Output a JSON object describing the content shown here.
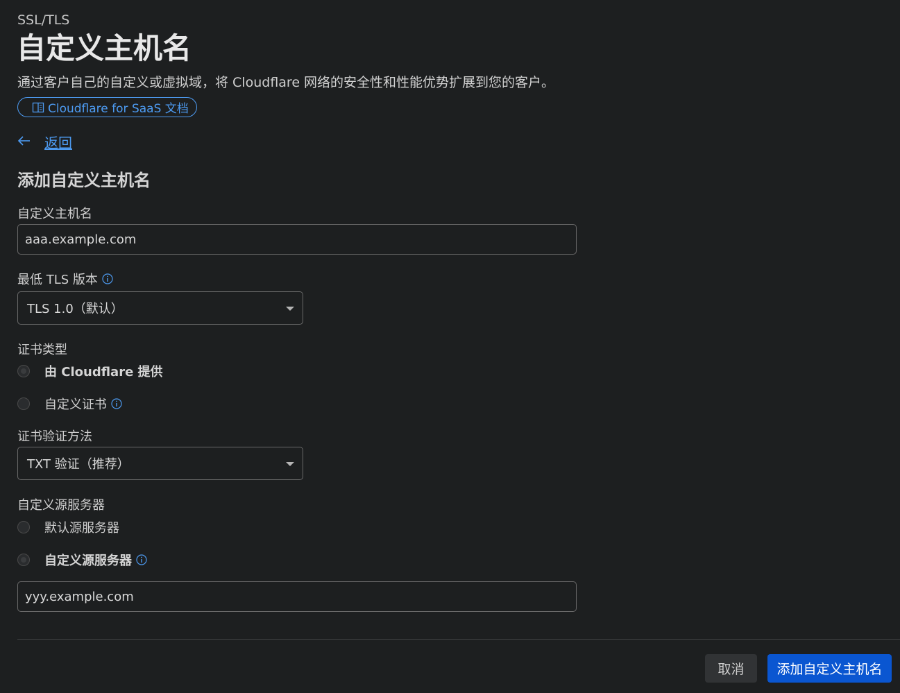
{
  "header": {
    "breadcrumb": "SSL/TLS",
    "title": "自定义主机名",
    "description": "通过客户自己的自定义或虚拟域，将 Cloudflare 网络的安全性和性能优势扩展到您的客户。",
    "docs_link": "Cloudflare for SaaS 文档"
  },
  "nav": {
    "back_label": "返回"
  },
  "form": {
    "section_title": "添加自定义主机名",
    "hostname": {
      "label": "自定义主机名",
      "value": "aaa.example.com"
    },
    "min_tls": {
      "label": "最低 TLS 版本",
      "selected": "TLS 1.0（默认）"
    },
    "cert_type": {
      "label": "证书类型",
      "options": [
        {
          "label": "由 Cloudflare 提供",
          "selected": true
        },
        {
          "label": "自定义证书",
          "selected": false
        }
      ]
    },
    "cert_validation": {
      "label": "证书验证方法",
      "selected": "TXT 验证（推荐）"
    },
    "origin_server": {
      "label": "自定义源服务器",
      "options": [
        {
          "label": "默认源服务器",
          "selected": false
        },
        {
          "label": "自定义源服务器",
          "selected": true
        }
      ],
      "value": "yyy.example.com"
    }
  },
  "actions": {
    "cancel_label": "取消",
    "submit_label": "添加自定义主机名"
  },
  "colors": {
    "background": "#1d1f20",
    "accent": "#4d9bf2",
    "primary_button": "#0a56d1"
  }
}
